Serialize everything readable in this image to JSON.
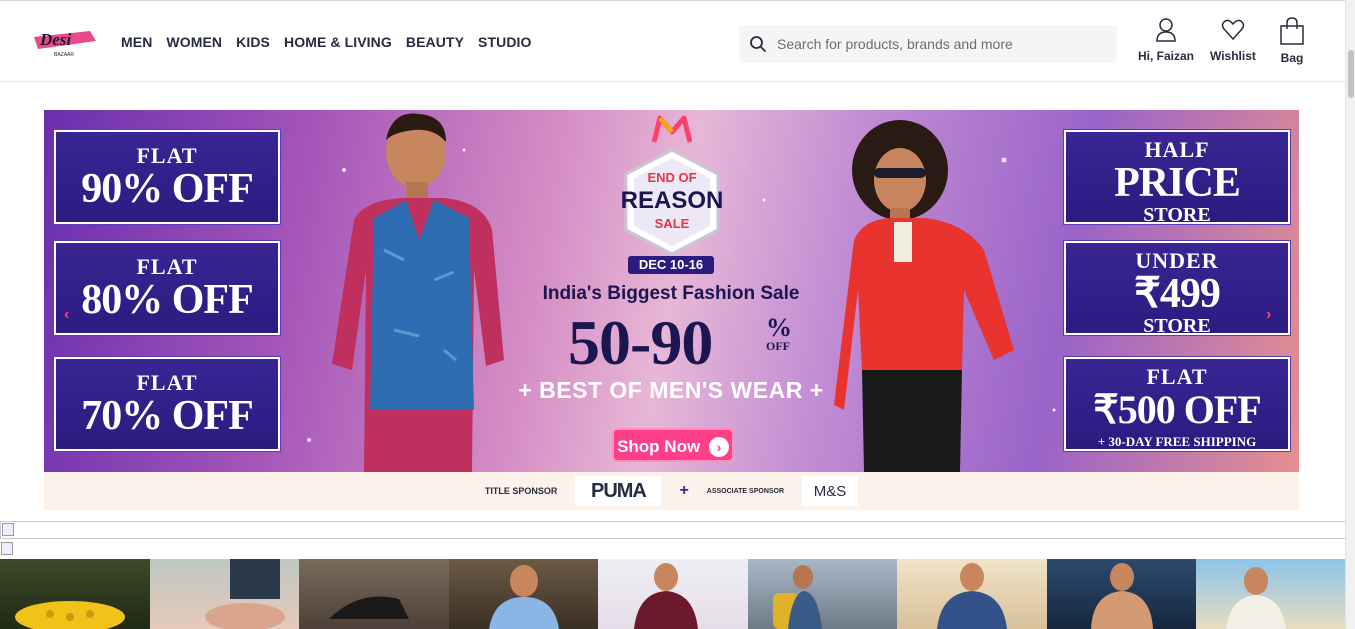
{
  "header": {
    "logo_text": "Desi",
    "logo_sub": "BAZAAR",
    "nav": [
      "MEN",
      "WOMEN",
      "KIDS",
      "HOME & LIVING",
      "BEAUTY",
      "STUDIO"
    ],
    "search_placeholder": "Search for products, brands and more",
    "profile_label": "Hi, Faizan",
    "wishlist_label": "Wishlist",
    "bag_label": "Bag"
  },
  "banner": {
    "left_offers": [
      {
        "line1": "FLAT",
        "line2": "90% OFF"
      },
      {
        "line1": "FLAT",
        "line2": "80% OFF"
      },
      {
        "line1": "FLAT",
        "line2": "70% OFF"
      }
    ],
    "right_offers": [
      {
        "line1": "HALF",
        "line2": "PRICE",
        "line3": "STORE"
      },
      {
        "line1": "UNDER",
        "line2": "₹499",
        "line3": "STORE"
      },
      {
        "line1": "FLAT",
        "line2": "₹500 OFF",
        "line3": "+ 30-DAY FREE SHIPPING"
      }
    ],
    "badge_line1": "END OF",
    "badge_line2": "REASON",
    "badge_line3": "SALE",
    "date": "DEC 10-16",
    "tagline": "India's Biggest Fashion Sale",
    "discount": "50-90",
    "pct_symbol": "%",
    "pct_off": "OFF",
    "subhead": "+ BEST OF MEN'S WEAR +",
    "cta": "Shop Now",
    "prev_arrow": "‹",
    "next_arrow": "›"
  },
  "sponsor": {
    "title_label": "TITLE SPONSOR",
    "title_brand": "PUMA",
    "plus": "+",
    "associate_label": "ASSOCIATE SPONSOR",
    "associate_brand": "M&S"
  },
  "colors": {
    "accent": "#ff3f6c",
    "offer_bg": "#2b1b80",
    "text_dark": "#282c3f"
  }
}
